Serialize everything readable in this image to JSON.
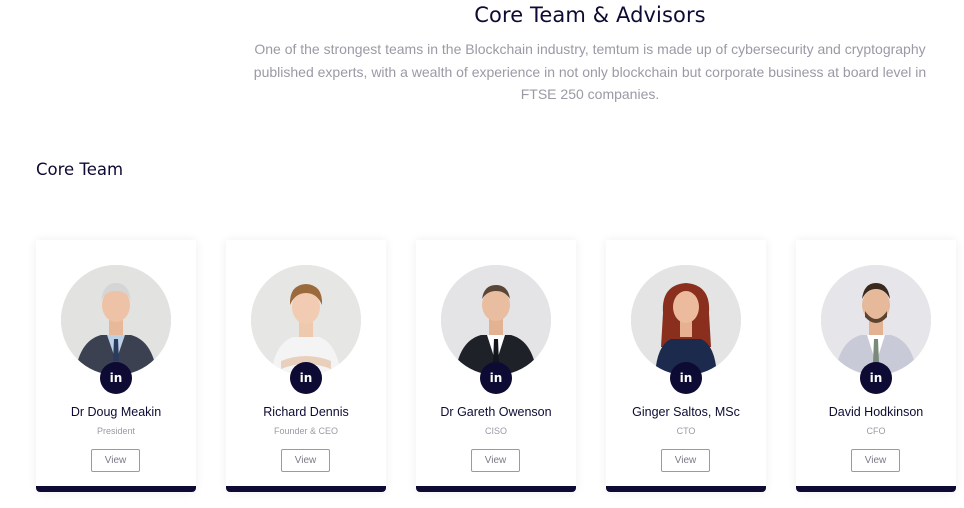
{
  "header": {
    "title": "Core Team & Advisors",
    "description": "One of the strongest teams in the Blockchain industry, temtum is made up of cybersecurity and cryptography published experts, with a wealth of experience in not only blockchain but corporate business at board level in FTSE 250 companies."
  },
  "section": {
    "title": "Core Team"
  },
  "members": [
    {
      "name": "Dr Doug Meakin",
      "role": "President",
      "linkedin_label": "in",
      "view_label": "View"
    },
    {
      "name": "Richard Dennis",
      "role": "Founder & CEO",
      "linkedin_label": "in",
      "view_label": "View"
    },
    {
      "name": "Dr Gareth Owenson",
      "role": "CISO",
      "linkedin_label": "in",
      "view_label": "View"
    },
    {
      "name": "Ginger Saltos, MSc",
      "role": "CTO",
      "linkedin_label": "in",
      "view_label": "View"
    },
    {
      "name": "David Hodkinson",
      "role": "CFO",
      "linkedin_label": "in",
      "view_label": "View"
    }
  ],
  "colors": {
    "primary": "#0d0b33",
    "muted": "#9a9aa6"
  },
  "icons": {
    "linkedin": "linkedin-icon"
  }
}
